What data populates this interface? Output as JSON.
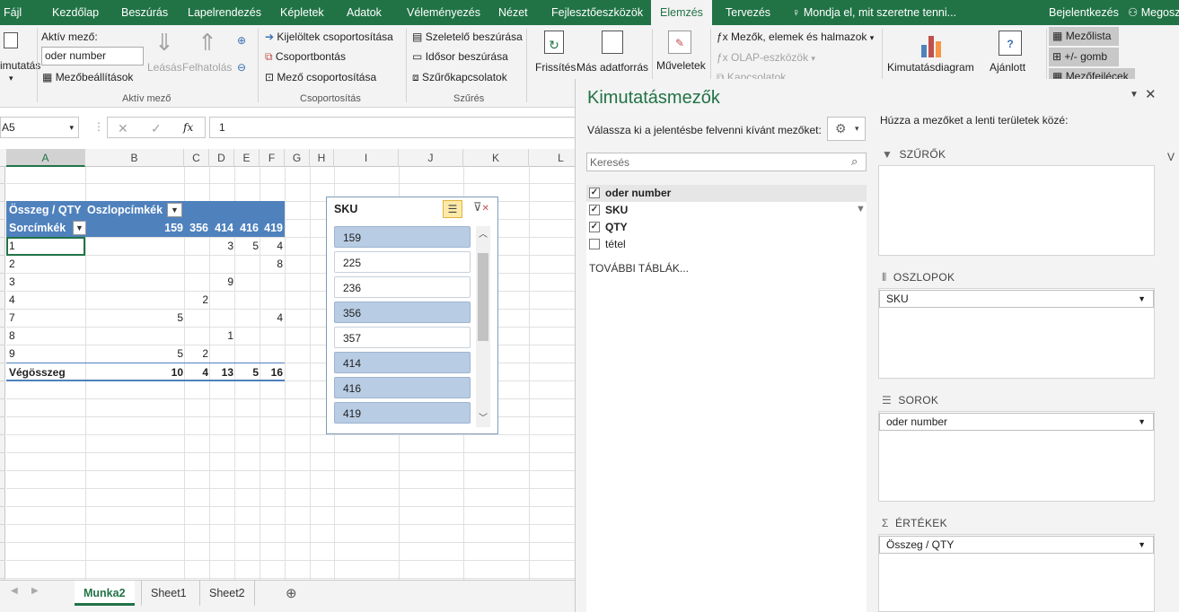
{
  "tabs": [
    "Fájl",
    "Kezdőlap",
    "Beszúrás",
    "Lapelrendezés",
    "Képletek",
    "Adatok",
    "Véleményezés",
    "Nézet",
    "Fejlesztőeszközök",
    "Elemzés",
    "Tervezés"
  ],
  "tell_me": "Mondja el, mit szeretne tenni...",
  "signin": "Bejelentkezés",
  "share": "Megosz",
  "ribbon": {
    "pivot_btn": "imutatás",
    "active_field_label": "Aktív mező:",
    "active_field_value": "oder number",
    "field_settings": "Mezőbeállítások",
    "drill_down": "Leásás",
    "drill_up": "Felhatolás",
    "group_active": "Aktív mező",
    "group_sel": "Kijelöltek csoportosítása",
    "ungroup": "Csoportbontás",
    "group_field": "Mező csoportosítása",
    "group_grouping": "Csoportosítás",
    "insert_slicer": "Szeletelő beszúrása",
    "insert_timeline": "Idősor beszúrása",
    "filter_conn": "Szűrőkapcsolatok",
    "group_filter": "Szűrés",
    "refresh": "Frissítés",
    "change_source": "Más adatforrás",
    "actions": "Műveletek",
    "fields_items": "Mezők, elemek és halmazok",
    "olap": "OLAP-eszközök",
    "relationships": "Kapcsolatok",
    "pivot_chart": "Kimutatásdiagram",
    "recommended": "Ajánlott",
    "field_list": "Mezőlista",
    "plus_minus": "+/- gomb",
    "field_headers": "Mezőfejlécek"
  },
  "formula": {
    "namebox": "A5",
    "fx": "fx",
    "value": "1"
  },
  "columns": [
    "A",
    "B",
    "C",
    "D",
    "E",
    "F",
    "G",
    "H",
    "I",
    "J",
    "K",
    "L"
  ],
  "pivot": {
    "sum_label": "Összeg / QTY",
    "col_labels": "Oszlopcímkék",
    "row_labels": "Sorcímkék",
    "col_heads": [
      "159",
      "356",
      "414",
      "416",
      "419"
    ],
    "rows": [
      {
        "label": "1",
        "v": [
          "",
          "",
          "3",
          "5",
          "4"
        ]
      },
      {
        "label": "2",
        "v": [
          "",
          "",
          "",
          "",
          "8"
        ]
      },
      {
        "label": "3",
        "v": [
          "",
          "",
          "9",
          "",
          ""
        ]
      },
      {
        "label": "4",
        "v": [
          "",
          "2",
          "",
          "",
          ""
        ]
      },
      {
        "label": "7",
        "v": [
          "5",
          "",
          "",
          "",
          "4"
        ]
      },
      {
        "label": "8",
        "v": [
          "",
          "",
          "1",
          "",
          ""
        ]
      },
      {
        "label": "9",
        "v": [
          "5",
          "2",
          "",
          "",
          ""
        ]
      }
    ],
    "total_label": "Végösszeg",
    "totals": [
      "10",
      "4",
      "13",
      "5",
      "16"
    ]
  },
  "slicer": {
    "title": "SKU",
    "items": [
      {
        "label": "159",
        "selected": true
      },
      {
        "label": "225",
        "selected": false
      },
      {
        "label": "236",
        "selected": false
      },
      {
        "label": "356",
        "selected": true
      },
      {
        "label": "357",
        "selected": false
      },
      {
        "label": "414",
        "selected": true
      },
      {
        "label": "416",
        "selected": true
      },
      {
        "label": "419",
        "selected": true
      }
    ]
  },
  "sheets": [
    "Munka2",
    "Sheet1",
    "Sheet2"
  ],
  "pane": {
    "title": "Kimutatásmezők",
    "choose": "Válassza ki a jelentésbe felvenni kívánt mezőket:",
    "drag": "Húzza a mezőket a lenti területek közé:",
    "search_placeholder": "Keresés",
    "fields": [
      {
        "name": "oder number",
        "checked": true
      },
      {
        "name": "SKU",
        "checked": true
      },
      {
        "name": "QTY",
        "checked": true
      },
      {
        "name": "tétel",
        "checked": false
      }
    ],
    "more_tables": "TOVÁBBI TÁBLÁK...",
    "filters": "SZŰRŐK",
    "columns": "OSZLOPOK",
    "columns_item": "SKU",
    "rows": "SOROK",
    "rows_item": "oder number",
    "values": "ÉRTÉKEK",
    "values_item": "Összeg / QTY"
  }
}
